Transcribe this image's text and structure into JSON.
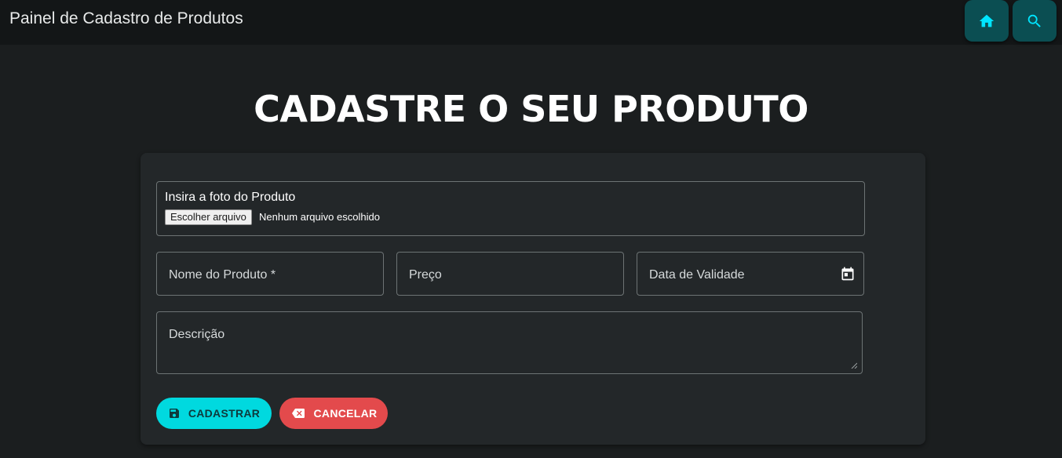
{
  "header": {
    "title": "Painel de Cadastro de Produtos",
    "home_icon": "home-icon",
    "search_icon": "search-icon",
    "accent_color": "#0b4e52",
    "icon_color": "#00e5ff"
  },
  "main": {
    "heading": "CADASTRE O SEU PRODUTO"
  },
  "form": {
    "photo": {
      "label": "Insira a foto do Produto",
      "button_label": "Escolher arquivo",
      "status": "Nenhum arquivo escolhido"
    },
    "name_placeholder": "Nome do Produto *",
    "price_placeholder": "Preço",
    "date_placeholder": "Data de Validade",
    "description_placeholder": "Descrição",
    "save_label": "CADASTRAR",
    "cancel_label": "CANCELAR",
    "save_icon": "floppy-disk-icon",
    "cancel_icon": "backspace-icon",
    "calendar_icon": "calendar-icon",
    "save_color": "#00d9df",
    "cancel_color": "#e34a4c"
  }
}
